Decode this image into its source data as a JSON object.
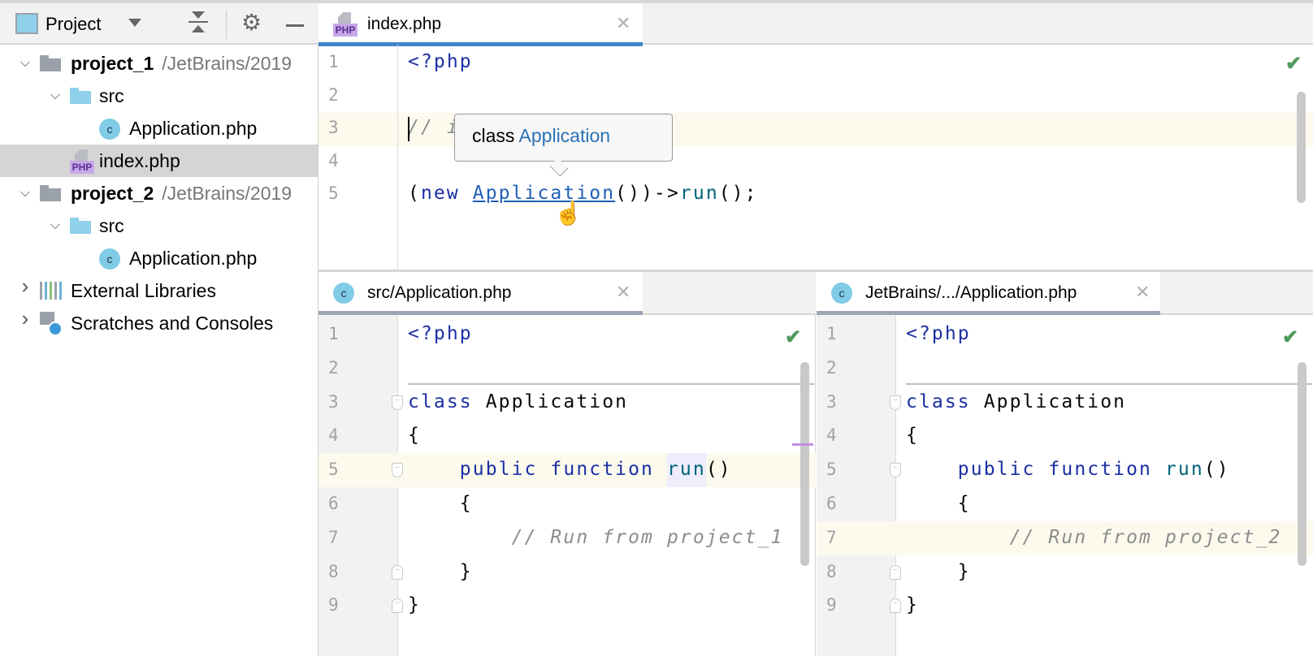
{
  "sidebar": {
    "title": "Project",
    "tree": [
      {
        "label": "project_1",
        "path": "/JetBrains/2019",
        "bold": true,
        "expanded": true,
        "level": 0,
        "icon": "folder-grey-icon"
      },
      {
        "label": "src",
        "level": 1,
        "expanded": true,
        "icon": "folder-blue-icon"
      },
      {
        "label": "Application.php",
        "level": 2,
        "icon": "php-class-icon"
      },
      {
        "label": "index.php",
        "level": 1,
        "icon": "php-file-icon",
        "selected": true
      },
      {
        "label": "project_2",
        "path": "/JetBrains/2019",
        "bold": true,
        "expanded": true,
        "level": 0,
        "icon": "folder-grey-icon"
      },
      {
        "label": "src",
        "level": 1,
        "expanded": true,
        "icon": "folder-blue-icon"
      },
      {
        "label": "Application.php",
        "level": 2,
        "icon": "php-class-icon"
      },
      {
        "label": "External Libraries",
        "level": 0,
        "expanded": false,
        "icon": "libraries-icon"
      },
      {
        "label": "Scratches and Consoles",
        "level": 0,
        "expanded": false,
        "icon": "scratches-icon"
      }
    ]
  },
  "icons": {
    "php_label": "PHP",
    "class_letter": "c"
  },
  "editors": [
    {
      "tab": "index.php",
      "lines": [
        [
          [
            "kw",
            "<?php"
          ]
        ],
        [],
        [
          [
            "cm",
            "// include project_1"
          ]
        ],
        [],
        [
          [
            "",
            "("
          ],
          [
            "kw",
            "new"
          ],
          [
            "",
            " "
          ],
          [
            "lnk",
            "Application"
          ],
          [
            "",
            "())->"
          ],
          [
            "fn",
            "run"
          ],
          [
            "",
            "();"
          ]
        ]
      ],
      "tooltip": {
        "prefix": "class",
        "name": "Application"
      }
    },
    {
      "tab": "src/Application.php",
      "lines": [
        [
          [
            "kw",
            "<?php"
          ]
        ],
        [],
        [
          [
            "kw",
            "class"
          ],
          [
            "",
            " Application"
          ]
        ],
        [
          [
            "",
            "{"
          ]
        ],
        [
          [
            "",
            "    "
          ],
          [
            "kw",
            "public function"
          ],
          [
            "",
            " "
          ],
          [
            "fn",
            "run"
          ],
          [
            "",
            "()"
          ]
        ],
        [
          [
            "",
            "    {"
          ]
        ],
        [
          [
            "cm",
            "        // Run from project_1"
          ]
        ],
        [
          [
            "",
            "    }"
          ]
        ],
        [
          [
            "",
            "}"
          ]
        ]
      ]
    },
    {
      "tab": "JetBrains/.../Application.php",
      "lines": [
        [
          [
            "kw",
            "<?php"
          ]
        ],
        [],
        [
          [
            "kw",
            "class"
          ],
          [
            "",
            " Application"
          ]
        ],
        [
          [
            "",
            "{"
          ]
        ],
        [
          [
            "",
            "    "
          ],
          [
            "kw",
            "public function"
          ],
          [
            "",
            " "
          ],
          [
            "fn",
            "run"
          ],
          [
            "",
            "()"
          ]
        ],
        [
          [
            "",
            "    {"
          ]
        ],
        [
          [
            "cm",
            "        // Run from project_2"
          ]
        ],
        [
          [
            "",
            "    }"
          ]
        ],
        [
          [
            "",
            "}"
          ]
        ]
      ]
    }
  ],
  "colors": {
    "active_tab": "#4083c9",
    "inactive_tab": "#9aa5b5",
    "keyword": "#1b2fa3",
    "function": "#00627a",
    "comment": "#8c8c8c",
    "inspection_ok": "#4f9a5c"
  }
}
